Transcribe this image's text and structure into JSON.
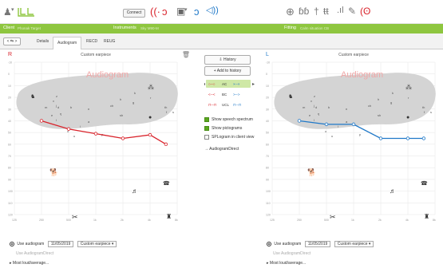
{
  "topbar": {
    "connect_label": "Connect",
    "left_icons": [
      "person-icon",
      "audiogram-icon"
    ],
    "mid_icons": [
      "ear-red-icon",
      "ear-red2-icon",
      "device-icon",
      "ear-blue-icon",
      "speaker-icon"
    ],
    "right_icons": [
      "globe-icon",
      "ear-pair-icon",
      "person-small-icon",
      "people-icon",
      "level-bars-icon",
      "tools-icon",
      "ear-hearing-icon"
    ]
  },
  "strip2": {
    "client_label": "Client",
    "client_value": "Phonak Target",
    "instruments_label": "Instruments",
    "instruments_value": "Sky M90-M",
    "fitting_label": "Fitting",
    "fitting_value": "Calm situation CB"
  },
  "tabs": {
    "nav_label": "< ⇆ >",
    "items": [
      {
        "label": "Details"
      },
      {
        "label": "Audiogram"
      },
      {
        "label": "RECD"
      },
      {
        "label": "REUG"
      }
    ]
  },
  "left_panel": {
    "title": "Custom earpiece",
    "watermark": "Audiogram",
    "marker": "R",
    "color": "#d9232b",
    "points": [
      [
        250,
        40
      ],
      [
        500,
        47
      ],
      [
        1000,
        51
      ],
      [
        2000,
        55
      ],
      [
        4000,
        52
      ],
      [
        6000,
        60
      ]
    ]
  },
  "right_panel": {
    "title": "Custom earpiece",
    "watermark": "Audiogram",
    "marker": "L",
    "color": "#1f78c8",
    "points": [
      [
        250,
        40
      ],
      [
        500,
        43
      ],
      [
        1000,
        43
      ],
      [
        2000,
        55
      ],
      [
        4000,
        55
      ],
      [
        6000,
        55
      ]
    ]
  },
  "chart_axes": {
    "x_ticks": [
      "125",
      "250",
      "500",
      "1k",
      "2k",
      "4k",
      "8k"
    ],
    "y_ticks": [
      "-10",
      "0",
      "10",
      "20",
      "30",
      "40",
      "50",
      "60",
      "70",
      "80",
      "90",
      "100",
      "110",
      "120"
    ]
  },
  "middle": {
    "history_label": "History",
    "add_history_label": "+ Add to history",
    "symbols": [
      "AC",
      "BC",
      "UCL"
    ],
    "show_speech_label": "Show speech spectrum",
    "show_pictograms_label": "Show pictograms",
    "splogram_label": "SPLogram in client view",
    "audiogram_direct_label": "→ AudiogramDirect"
  },
  "footer_left": {
    "use_audiogram_label": "Use audiogram",
    "date_value": "11/05/2019",
    "earpiece_value": "Custom earpiece ▾",
    "use_direct_label": "Use AudiogramDirect",
    "more_label": "▸ Most loud/average..."
  },
  "footer_right": {
    "use_audiogram_label": "Use audiogram",
    "date_value": "11/05/2019",
    "earpiece_value": "Custom earpiece ▾",
    "use_direct_label": "Use AudiogramDirect",
    "more_label": "▸ Most loud/average..."
  }
}
